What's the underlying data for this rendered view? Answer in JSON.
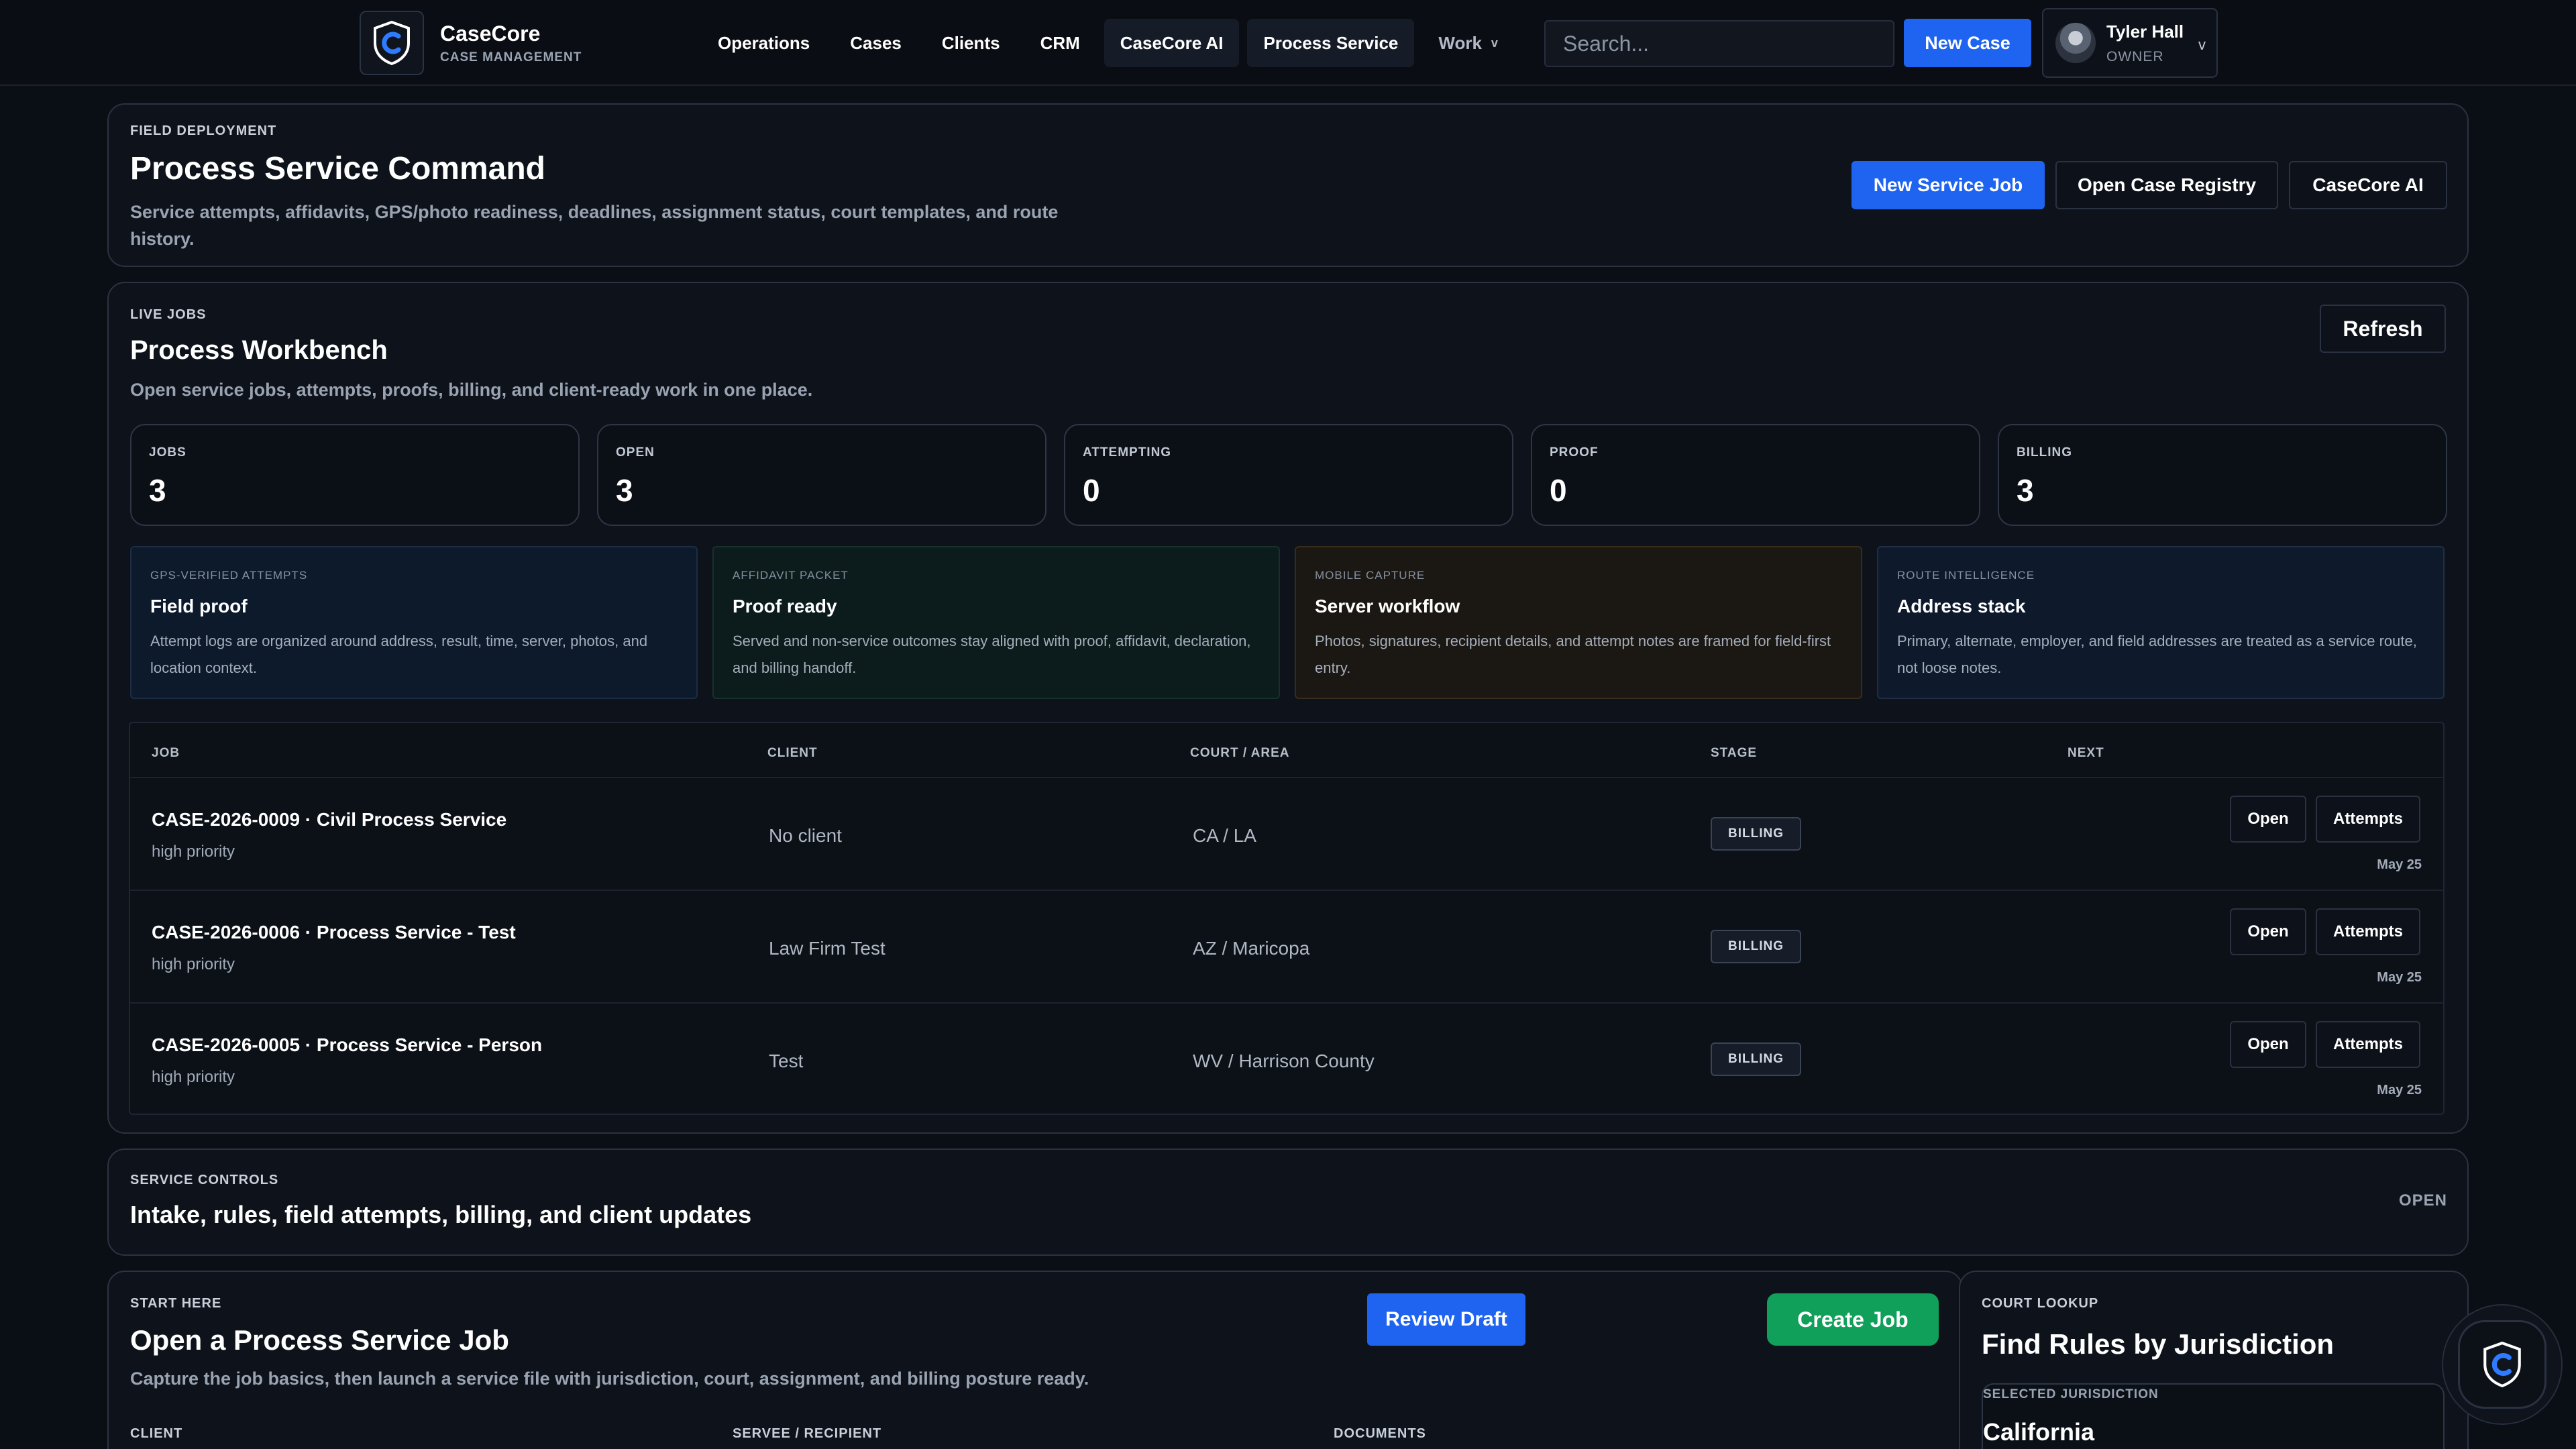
{
  "header": {
    "brand_name": "CaseCore",
    "brand_sub": "CASE MANAGEMENT",
    "nav": [
      "Operations",
      "Cases",
      "Clients",
      "CRM",
      "CaseCore AI",
      "Process Service"
    ],
    "nav_work": "Work",
    "search_placeholder": "Search...",
    "new_case": "New Case",
    "user": {
      "name": "Tyler Hall",
      "role": "OWNER"
    }
  },
  "hero": {
    "eyebrow": "FIELD DEPLOYMENT",
    "title": "Process Service Command",
    "desc_line1": "Service attempts, affidavits, GPS/photo readiness, deadlines, assignment status, court templates, and route",
    "desc_line2": "history.",
    "btn_new_job": "New Service Job",
    "btn_registry": "Open Case Registry",
    "btn_ai": "CaseCore AI"
  },
  "workbench": {
    "eyebrow": "LIVE JOBS",
    "title": "Process Workbench",
    "desc": "Open service jobs, attempts, proofs, billing, and client-ready work in one place.",
    "refresh": "Refresh",
    "stats": [
      {
        "label": "JOBS",
        "value": "3"
      },
      {
        "label": "OPEN",
        "value": "3"
      },
      {
        "label": "ATTEMPTING",
        "value": "0"
      },
      {
        "label": "PROOF",
        "value": "0"
      },
      {
        "label": "BILLING",
        "value": "3"
      }
    ],
    "features": [
      {
        "label": "GPS-VERIFIED ATTEMPTS",
        "title": "Field proof",
        "text": "Attempt logs are organized around address, result, time, server, photos, and location context."
      },
      {
        "label": "AFFIDAVIT PACKET",
        "title": "Proof ready",
        "text": "Served and non-service outcomes stay aligned with proof, affidavit, declaration, and billing handoff."
      },
      {
        "label": "MOBILE CAPTURE",
        "title": "Server workflow",
        "text": "Photos, signatures, recipient details, and attempt notes are framed for field-first entry."
      },
      {
        "label": "ROUTE INTELLIGENCE",
        "title": "Address stack",
        "text": "Primary, alternate, employer, and field addresses are treated as a service route, not loose notes."
      }
    ],
    "columns": {
      "job": "JOB",
      "client": "CLIENT",
      "area": "COURT / AREA",
      "stage": "STAGE",
      "next": "NEXT"
    },
    "rows": [
      {
        "job": "CASE-2026-0009 · Civil Process Service",
        "priority": "high priority",
        "client": "No client",
        "area": "CA / LA",
        "stage": "BILLING",
        "open": "Open",
        "attempts": "Attempts",
        "date": "May 25"
      },
      {
        "job": "CASE-2026-0006 · Process Service - Test",
        "priority": "high priority",
        "client": "Law Firm Test",
        "area": "AZ / Maricopa",
        "stage": "BILLING",
        "open": "Open",
        "attempts": "Attempts",
        "date": "May 25"
      },
      {
        "job": "CASE-2026-0005 · Process Service - Person",
        "priority": "high priority",
        "client": "Test",
        "area": "WV / Harrison County",
        "stage": "BILLING",
        "open": "Open",
        "attempts": "Attempts",
        "date": "May 25"
      }
    ]
  },
  "controls": {
    "eyebrow": "SERVICE CONTROLS",
    "title": "Intake, rules, field attempts, billing, and client updates",
    "state": "OPEN"
  },
  "start": {
    "eyebrow": "START HERE",
    "title": "Open a Process Service Job",
    "desc": "Capture the job basics, then launch a service file with jurisdiction, court, assignment, and billing posture ready.",
    "review": "Review Draft",
    "create": "Create Job",
    "col_client": "CLIENT",
    "col_serve": "SERVEE / RECIPIENT",
    "col_docs": "DOCUMENTS"
  },
  "court": {
    "eyebrow": "COURT LOOKUP",
    "title": "Find Rules by Jurisdiction",
    "field_label": "SELECTED JURISDICTION",
    "field_value": "California"
  },
  "colors": {
    "primary": "#1f64f0",
    "success": "#11a05a",
    "background": "#0a0e15"
  }
}
